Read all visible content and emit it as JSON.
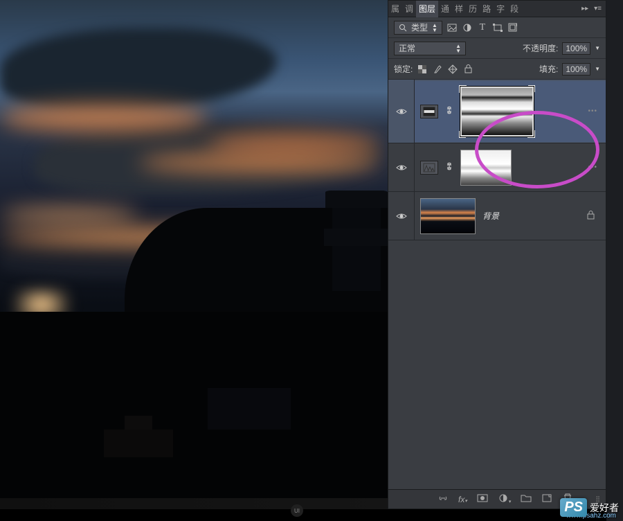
{
  "tabs": {
    "t1": "属",
    "t2": "调",
    "active": "图层",
    "t3": "通",
    "t4": "样",
    "t5": "历",
    "t6": "路",
    "t7": "字",
    "t8": "段"
  },
  "filter": {
    "label": "类型"
  },
  "blend": {
    "mode": "正常",
    "opacity_label": "不透明度:",
    "opacity_value": "100%"
  },
  "lock": {
    "label": "锁定:",
    "fill_label": "填充:",
    "fill_value": "100%"
  },
  "layers": {
    "bg_name": "背景"
  },
  "watermark": {
    "logo": "PS",
    "text": "爱好者",
    "url": "www.psahz.com"
  },
  "badge": "UI"
}
